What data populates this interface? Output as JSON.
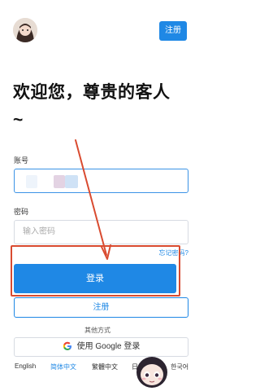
{
  "header": {
    "avatar_icon": "user-avatar",
    "register_label": "注册"
  },
  "welcome": {
    "title": "欢迎您，尊贵的客人 ~"
  },
  "form": {
    "account_label": "账号",
    "password_label": "密码",
    "password_placeholder": "输入密码",
    "forgot_label": "忘记密码?",
    "login_label": "登录",
    "register_label": "注册"
  },
  "other_methods": {
    "title": "其他方式",
    "google_label": "使用 Google 登录",
    "google_icon": "google-g-icon"
  },
  "languages": [
    {
      "label": "English",
      "active": false
    },
    {
      "label": "简体中文",
      "active": true
    },
    {
      "label": "繁體中文",
      "active": false
    },
    {
      "label": "日",
      "active": false
    },
    {
      "label": "한국어",
      "active": false
    }
  ],
  "colors": {
    "accent": "#1f88e5",
    "annotation": "#d94b30"
  }
}
